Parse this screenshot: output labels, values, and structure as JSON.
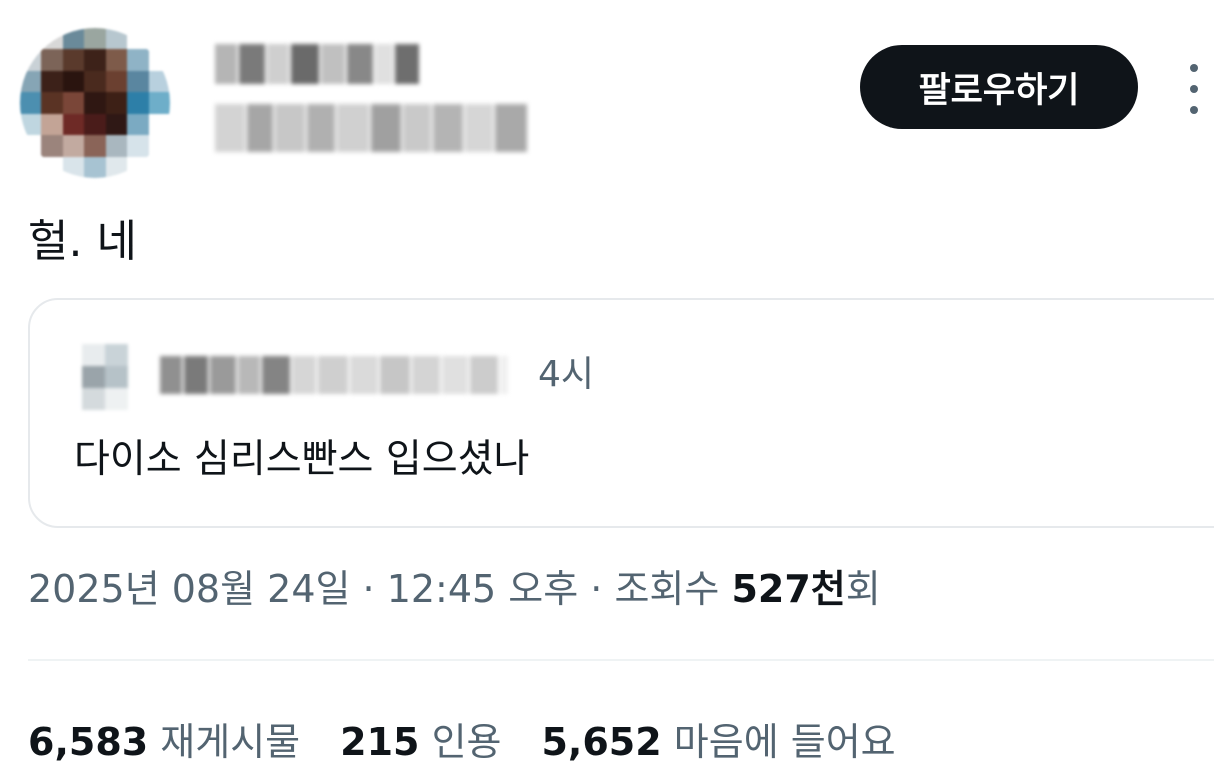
{
  "header": {
    "follow_label": "팔로우하기"
  },
  "tweet": {
    "text": "헐. 네"
  },
  "quote": {
    "time": "4시",
    "text": "다이소 심리스빤스 입으셨나"
  },
  "meta": {
    "date": "2025년 08월 24일",
    "separator1": " · ",
    "time": "12:45 오후",
    "separator2": " · ",
    "views_label": "조회수 ",
    "views_num": "527천",
    "views_suffix": "회"
  },
  "stats": {
    "retweets_num": "6,583",
    "retweets_label": "재게시물",
    "quotes_num": "215",
    "quotes_label": "인용",
    "likes_num": "5,652",
    "likes_label": "마음에 들어요"
  },
  "colors": {
    "text_primary": "#0f1419",
    "text_secondary": "#536471",
    "follow_bg": "#0f1419",
    "border": "#e6e9ec"
  },
  "icons": {
    "more": "more-vertical-icon"
  }
}
